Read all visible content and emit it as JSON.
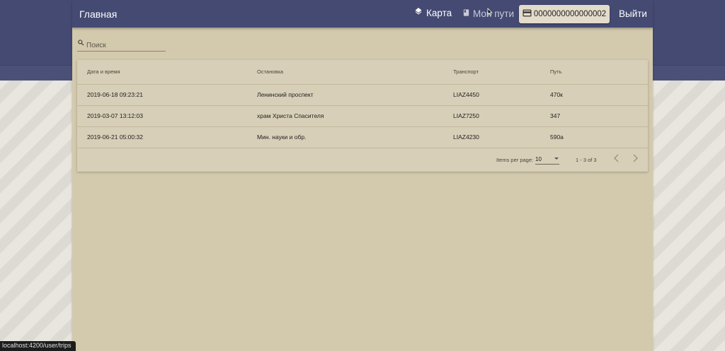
{
  "app": {
    "title": "Главная"
  },
  "nav": {
    "map_label": "Карта",
    "map_icon": "layers-icon",
    "trips_label": "Мои пути",
    "trips_icon": "book-icon",
    "card_number": "0000000000000002",
    "card_icon": "credit-card-icon",
    "logout_label": "Выйти"
  },
  "search": {
    "placeholder": "Поиск",
    "icon": "search-icon"
  },
  "table": {
    "columns": [
      "Дата и время",
      "Остановка",
      "Транспорт",
      "Путь"
    ],
    "rows": [
      [
        "2019-06-18 09:23:21",
        "Ленинский проспект",
        "LIAZ4450",
        "470к"
      ],
      [
        "2019-03-07 13:12:03",
        "храм Христа Спасителя",
        "LIAZ7250",
        "347"
      ],
      [
        "2019-06-21 05:00:32",
        "Мин. науки и обр.",
        "LIAZ4230",
        "590а"
      ]
    ]
  },
  "paginator": {
    "items_per_page_label": "Items per page:",
    "page_size": "10",
    "range_label": "1 - 3 of 3"
  },
  "status_bar": {
    "url": "localhost:4200/user/trips"
  },
  "colors": {
    "toolbar": "#444a72",
    "content_bg": "#d3c9ad",
    "card_button": "#e3dccb"
  }
}
